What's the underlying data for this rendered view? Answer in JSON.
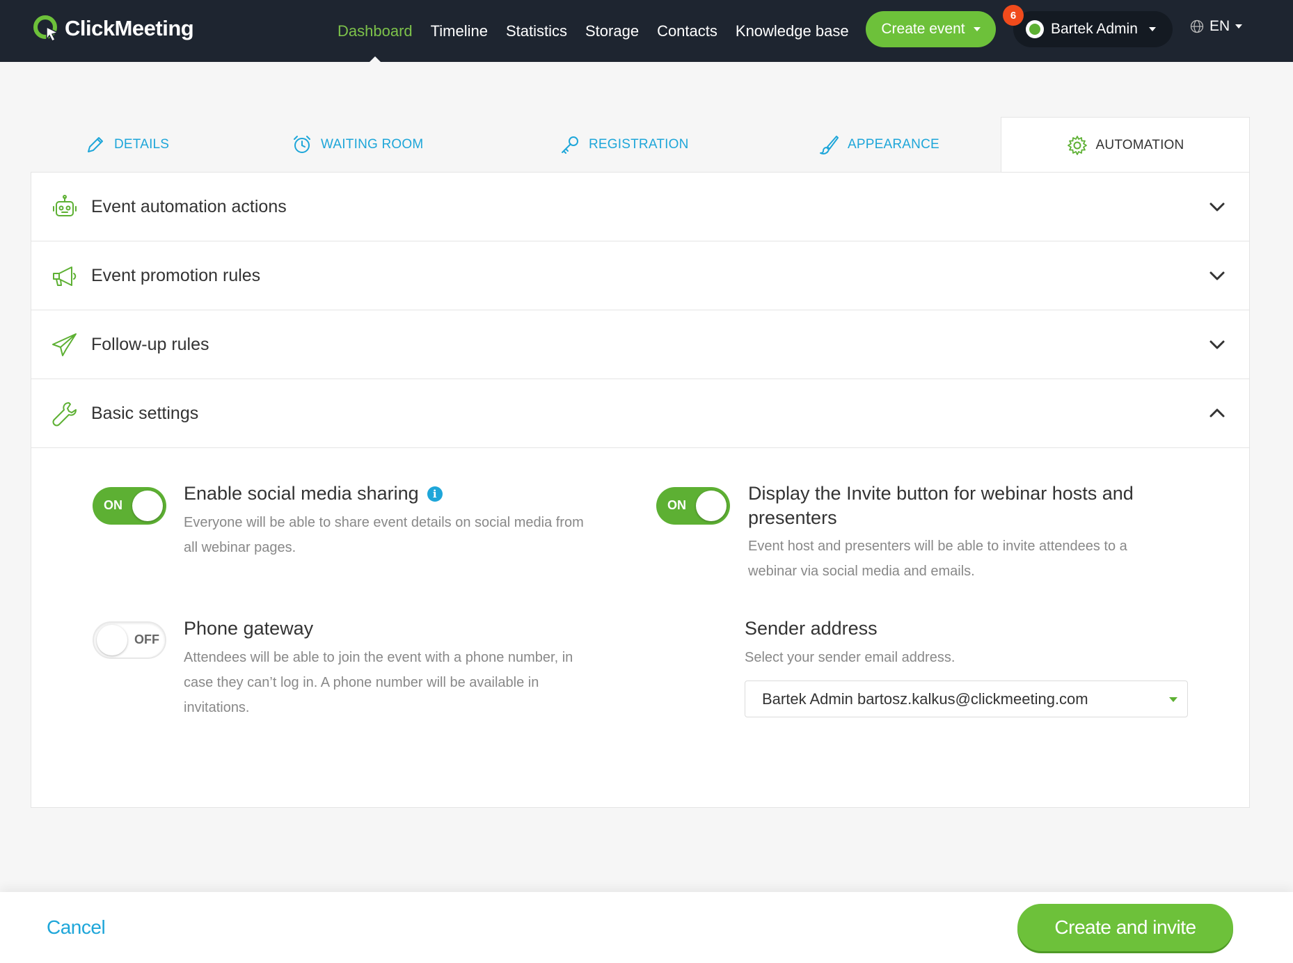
{
  "brand": {
    "name": "ClickMeeting"
  },
  "nav": {
    "items": [
      {
        "label": "Dashboard",
        "active": true
      },
      {
        "label": "Timeline"
      },
      {
        "label": "Statistics"
      },
      {
        "label": "Storage"
      },
      {
        "label": "Contacts"
      },
      {
        "label": "Knowledge base"
      }
    ],
    "create_event_label": "Create event",
    "notifications_count": "6",
    "user_name": "Bartek Admin",
    "language": "EN"
  },
  "tabs": [
    {
      "label": "DETAILS",
      "icon": "pencil-icon"
    },
    {
      "label": "WAITING ROOM",
      "icon": "alarm-clock-icon"
    },
    {
      "label": "REGISTRATION",
      "icon": "key-icon"
    },
    {
      "label": "APPEARANCE",
      "icon": "brush-icon"
    },
    {
      "label": "AUTOMATION",
      "icon": "gear-icon",
      "active": true
    }
  ],
  "sections": [
    {
      "title": "Event automation actions",
      "icon": "robot-icon",
      "expanded": false
    },
    {
      "title": "Event promotion rules",
      "icon": "megaphone-icon",
      "expanded": false
    },
    {
      "title": "Follow-up rules",
      "icon": "paper-plane-icon",
      "expanded": false
    },
    {
      "title": "Basic settings",
      "icon": "wrench-icon",
      "expanded": true
    }
  ],
  "settings": {
    "social_sharing": {
      "state": "ON",
      "title": "Enable social media sharing",
      "desc_line1": "Everyone will be able to share event details on social media from",
      "desc_line2": "all webinar pages."
    },
    "invite_button": {
      "state": "ON",
      "title_line1": "Display the Invite button for webinar hosts and",
      "title_line2": "presenters",
      "desc_line1": "Event host and presenters will be able to invite attendees to a",
      "desc_line2": "webinar via social media and emails."
    },
    "phone_gateway": {
      "state": "OFF",
      "title": "Phone gateway",
      "desc_line1": "Attendees will be able to join the event with a phone number, in",
      "desc_line2": "case they can’t log in. A phone number will be available in",
      "desc_line3": "invitations."
    },
    "sender": {
      "title": "Sender address",
      "desc": "Select your sender email address.",
      "selected": "Bartek Admin bartosz.kalkus@clickmeeting.com"
    }
  },
  "footer": {
    "cancel_label": "Cancel",
    "submit_label": "Create and invite"
  },
  "colors": {
    "green": "#5db033",
    "blue": "#1ea6d9",
    "topbar": "#1e2530"
  }
}
